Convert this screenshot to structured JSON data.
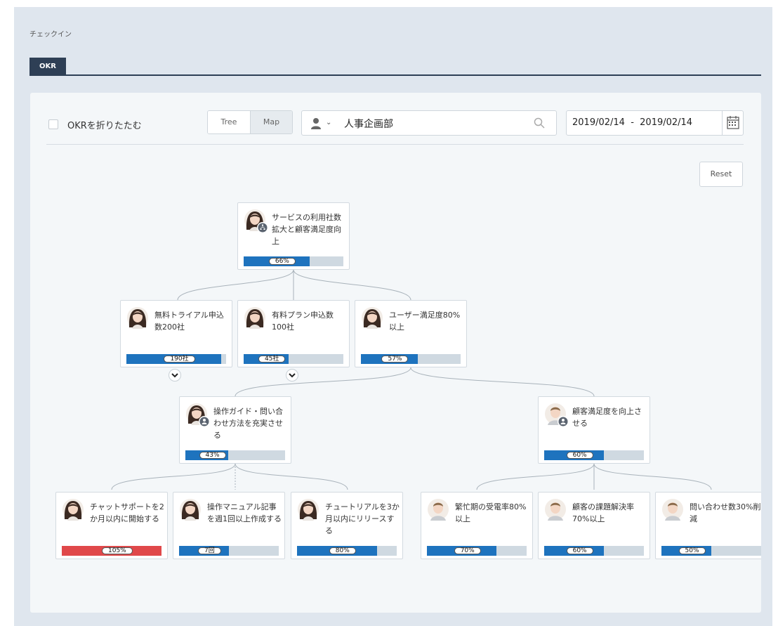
{
  "breadcrumb": "チェックイン",
  "tab": {
    "label": "OKR"
  },
  "toolbar": {
    "collapse_label": "OKRを折りたたむ",
    "view_tree": "Tree",
    "view_map": "Map",
    "search_value": "人事企画部",
    "date_range": "2019/02/14  -  2019/02/14",
    "reset_label": "Reset"
  },
  "okr": {
    "root": {
      "title": "サービスの利用社数拡大と顧客満足度向上",
      "label": "66%",
      "progress": 0.66
    },
    "l1": [
      {
        "title": "無料トライアル申込数200社",
        "label": "190社",
        "progress": 0.95
      },
      {
        "title": "有料プラン申込数100社",
        "label": "45社",
        "progress": 0.45
      },
      {
        "title": "ユーザー満足度80%以上",
        "label": "57%",
        "progress": 0.57
      }
    ],
    "l2": [
      {
        "title": "操作ガイド・問い合わせ方法を充実させる",
        "label": "43%",
        "progress": 0.43
      },
      {
        "title": "顧客満足度を向上させる",
        "label": "60%",
        "progress": 0.6
      }
    ],
    "l3": [
      {
        "title": "チャットサポートを2か月以内に開始する",
        "label": "105%",
        "progress": 1.0,
        "over": true
      },
      {
        "title": "操作マニュアル記事を週1回以上作成する",
        "label": "7回",
        "progress": 0.5
      },
      {
        "title": "チュートリアルを3か月以内にリリースする",
        "label": "80%",
        "progress": 0.8
      },
      {
        "title": "繁忙期の受電率80%以上",
        "label": "70%",
        "progress": 0.7
      },
      {
        "title": "顧客の課題解決率70%以上",
        "label": "60%",
        "progress": 0.6
      },
      {
        "title": "問い合わせ数30%削減",
        "label": "50%",
        "progress": 0.5
      }
    ]
  },
  "colors": {
    "accent": "#1e73be",
    "over": "#e0484a",
    "tab": "#2e3f55"
  }
}
